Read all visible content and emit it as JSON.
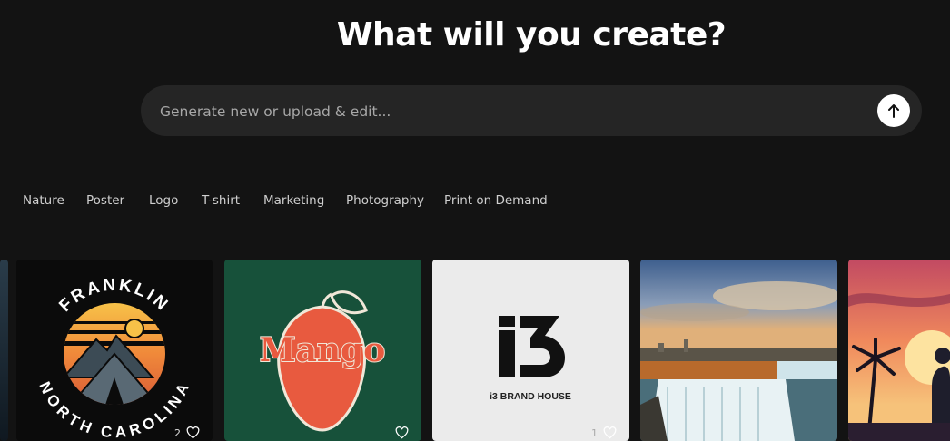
{
  "headline": "What will you create?",
  "prompt": {
    "placeholder": "Generate new or upload & edit...",
    "submit_icon": "arrow-up-icon"
  },
  "categories": [
    "Nature",
    "Poster",
    "Logo",
    "T-shirt",
    "Marketing",
    "Photography",
    "Print on Demand"
  ],
  "cards": [
    {
      "type": "franklin-logo",
      "top_text": "FRANKLIN",
      "bottom_text": "NORTH CAROLINA",
      "likes": "2"
    },
    {
      "type": "mango-logo",
      "text": "Mango",
      "likes": ""
    },
    {
      "type": "i3-logo",
      "mark": "i3",
      "caption": "i3 BRAND HOUSE",
      "likes": "1"
    },
    {
      "type": "waterfall-photo",
      "likes": ""
    },
    {
      "type": "sunset-poster",
      "likes": ""
    }
  ],
  "colors": {
    "background": "#131313",
    "input_bg": "#252525",
    "mango_card": "#17513a",
    "mango_fruit": "#e85a3f",
    "i3_card": "#ebebeb"
  }
}
